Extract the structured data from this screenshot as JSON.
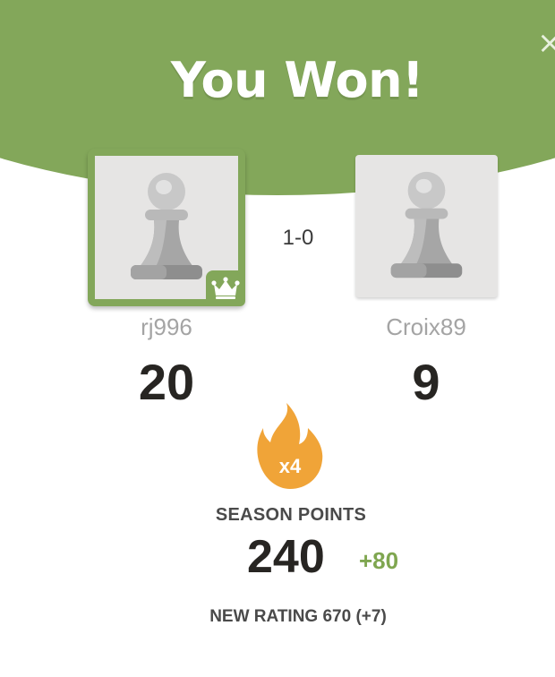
{
  "modal": {
    "title": "You Won!",
    "close_label": "×"
  },
  "game": {
    "result": "1-0"
  },
  "players": {
    "winner": {
      "name": "rj996",
      "score": "20"
    },
    "loser": {
      "name": "Croix89",
      "score": "9"
    }
  },
  "season": {
    "multiplier": "x4",
    "label": "SEASON POINTS",
    "points": "240",
    "delta": "+80"
  },
  "rating": {
    "text": "NEW RATING 670 (+7)"
  },
  "colors": {
    "accent_green": "#83a75a",
    "positive_green": "#7fa650",
    "flame_orange": "#f0a438",
    "avatar_bg": "#e6e5e4",
    "dark_text": "#272522",
    "muted_text": "#a4a4a4"
  },
  "icons": {
    "winner_avatar": "pawn-icon",
    "loser_avatar": "pawn-icon",
    "winner_badge": "crown-icon",
    "streak": "flame-icon"
  }
}
